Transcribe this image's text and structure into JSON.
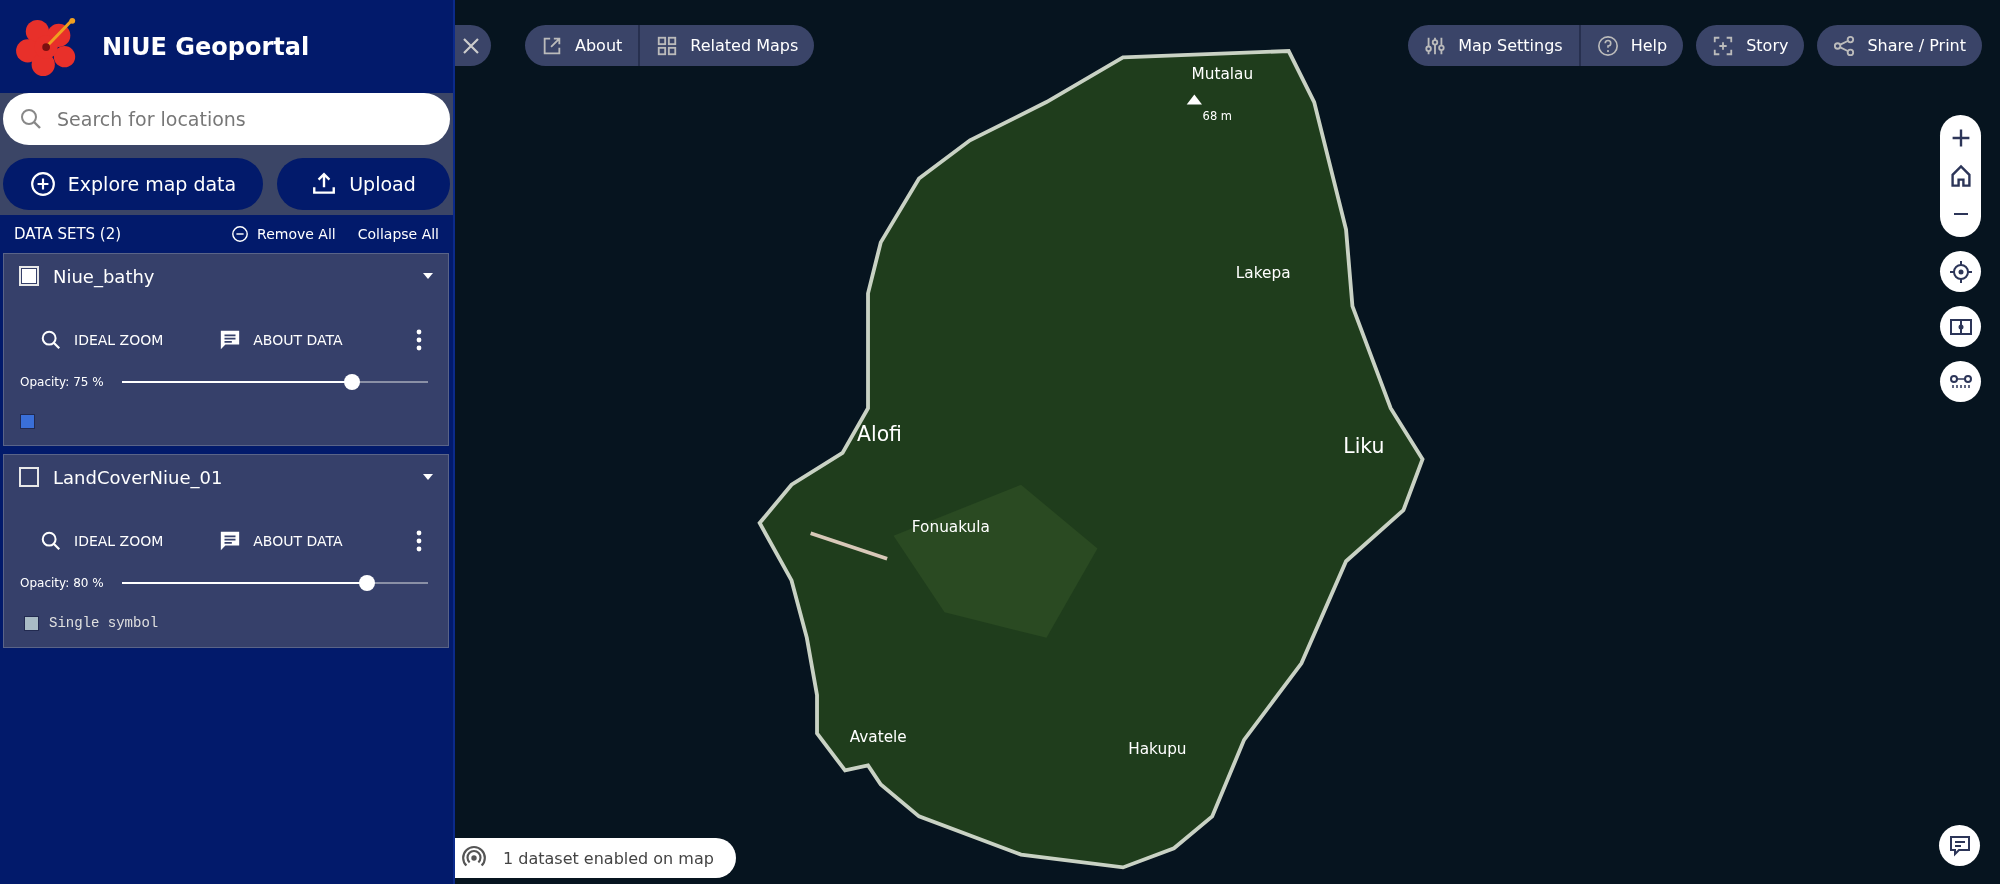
{
  "header": {
    "title": "NIUE Geoportal"
  },
  "search": {
    "placeholder": "Search for locations"
  },
  "actions": [
    {
      "label": "Explore map data",
      "kind": "explore"
    },
    {
      "label": "Upload",
      "kind": "upload"
    }
  ],
  "datasets_header": {
    "title": "DATA SETS (2)",
    "remove_all": "Remove All",
    "collapse_all": "Collapse All"
  },
  "datasets": [
    {
      "name": "Niue_bathy",
      "checked": true,
      "zoom_label": "IDEAL ZOOM",
      "about_label": "ABOUT DATA",
      "opacity_label": "Opacity: 75 %",
      "level": 0.75,
      "legend": {
        "color": "#3a6fd8"
      }
    },
    {
      "name": "LandCoverNiue_01",
      "checked": false,
      "zoom_label": "IDEAL ZOOM",
      "about_label": "ABOUT DATA",
      "opacity_label": "Opacity: 80 %",
      "level": 0.8,
      "legend": {
        "color": "#a9bcc6",
        "label": "Single symbol"
      }
    }
  ],
  "map": {
    "labels": [
      {
        "text": "Mutalau",
        "kind": "place"
      },
      {
        "text": "68 m",
        "kind": "peak"
      },
      {
        "text": "Lakepa",
        "kind": "place"
      },
      {
        "text": "Alofi",
        "kind": "major"
      },
      {
        "text": "Liku",
        "kind": "major"
      },
      {
        "text": "Fonuakula",
        "kind": "place"
      },
      {
        "text": "Avatele",
        "kind": "place"
      },
      {
        "text": "Hakupu",
        "kind": "place"
      }
    ]
  },
  "toolbar_left": [
    {
      "label": "About",
      "kind": "external"
    },
    {
      "label": "Related Maps",
      "kind": "grid"
    }
  ],
  "toolbar_right": [
    {
      "label": "Map Settings",
      "kind": "sliders"
    },
    {
      "label": "Help",
      "kind": "help"
    },
    {
      "label": "Story",
      "kind": "story"
    },
    {
      "label": "Share / Print",
      "kind": "share"
    }
  ],
  "status": {
    "text": "1 dataset enabled on map"
  }
}
